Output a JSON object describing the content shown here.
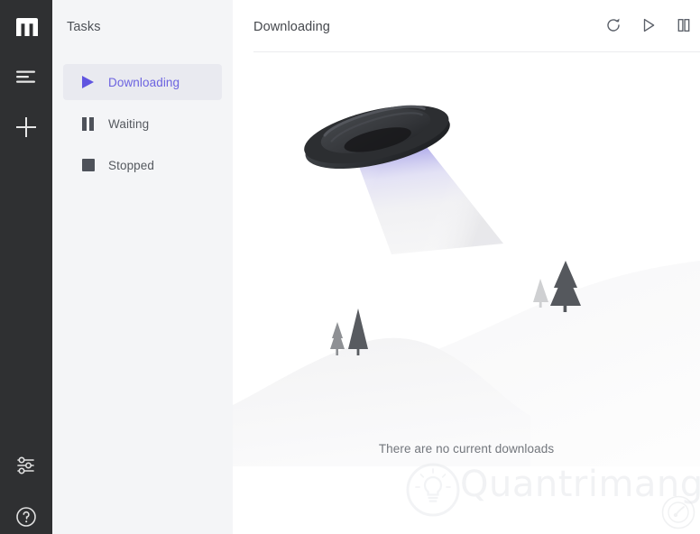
{
  "app": {
    "name": "Motrix",
    "logo_icon": "motrix-m-logo"
  },
  "rail": {
    "items": [
      {
        "name": "menu",
        "icon": "hamburger-menu-icon",
        "label": "Menu"
      },
      {
        "name": "add",
        "icon": "plus-icon",
        "label": "New Task"
      },
      {
        "name": "settings",
        "icon": "sliders-settings-icon",
        "label": "Preferences"
      },
      {
        "name": "help",
        "icon": "question-circle-icon",
        "label": "Help"
      }
    ]
  },
  "sidebar": {
    "title": "Tasks",
    "items": [
      {
        "label": "Downloading",
        "icon": "play-triangle-icon",
        "active": true
      },
      {
        "label": "Waiting",
        "icon": "pause-bars-icon",
        "active": false
      },
      {
        "label": "Stopped",
        "icon": "stop-square-icon",
        "active": false
      }
    ]
  },
  "header": {
    "title": "Downloading",
    "actions": [
      {
        "name": "refresh",
        "icon": "refresh-circular-arrow-icon",
        "label": "Refresh"
      },
      {
        "name": "resume-all",
        "icon": "play-outline-icon",
        "label": "Resume All"
      },
      {
        "name": "pause-all",
        "icon": "pause-outline-icon",
        "label": "Pause All"
      }
    ]
  },
  "main": {
    "empty_message": "There are no current downloads",
    "illustration": "ufo-beam-hills-trees"
  },
  "watermark": {
    "text": "Quantrimang",
    "logo_icon": "lightbulb-circle-icon"
  },
  "corner": {
    "icon": "speedometer-gauge-icon"
  },
  "colors": {
    "rail_bg": "#2f3032",
    "sidebar_bg": "#f4f5f7",
    "main_bg": "#ffffff",
    "accent": "#6055e0",
    "active_item_bg": "#e9eaf0",
    "text_primary": "#45484d",
    "text_secondary": "#72767c",
    "ufo_body": "#333538",
    "beam_top": "#6f68d6"
  }
}
